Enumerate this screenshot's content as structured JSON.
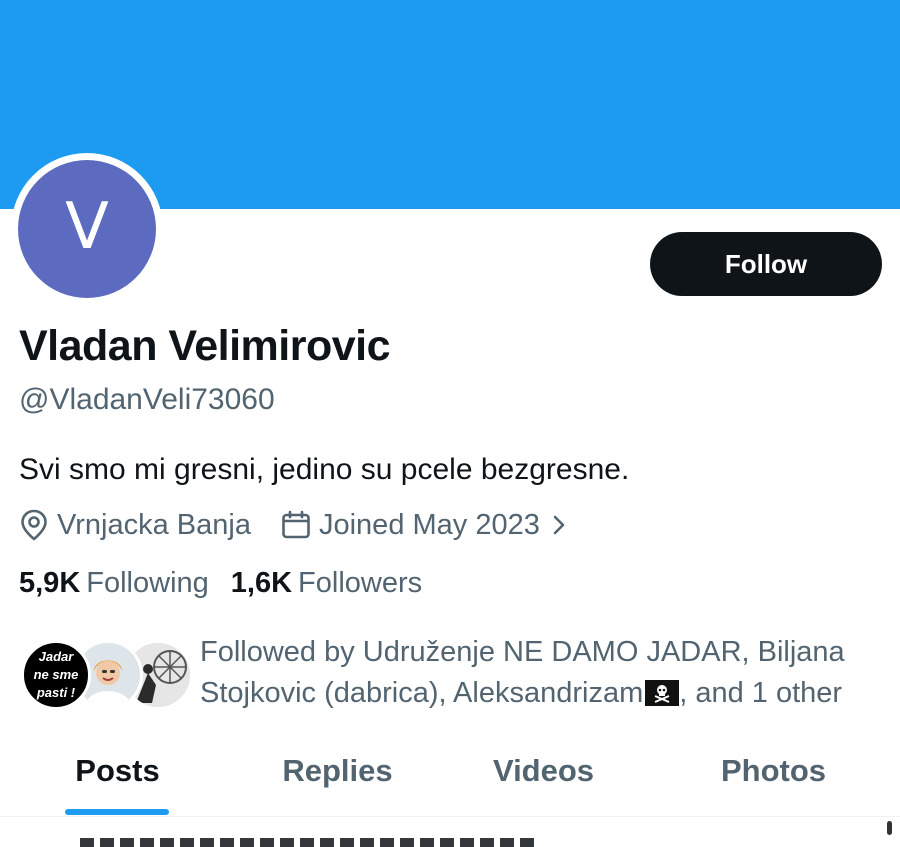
{
  "profile": {
    "avatar_letter": "V",
    "display_name": "Vladan Velimirovic",
    "handle": "@VladanVeli73060",
    "bio": "Svi smo mi gresni, jedino su pcele bezgresne.",
    "location": "Vrnjacka Banja",
    "joined": "Joined May 2023"
  },
  "actions": {
    "follow_label": "Follow"
  },
  "stats": {
    "following_count": "5,9K",
    "following_label": "Following",
    "followers_count": "1,6K",
    "followers_label": "Followers"
  },
  "followed_by": {
    "prefix": "Followed by Udruženje NE DAMO JADAR, Biljana Stojkovic (dabrica), Aleksandrizam",
    "suffix": ", and 1 other",
    "avatar_1_text": [
      "Jadar",
      "ne sme",
      "pasti !"
    ]
  },
  "tabs": [
    {
      "label": "Posts",
      "active": true
    },
    {
      "label": "Replies",
      "active": false
    },
    {
      "label": "Videos",
      "active": false
    },
    {
      "label": "Photos",
      "active": false
    }
  ],
  "colors": {
    "banner": "#1d9bf0",
    "avatar": "#5c6bc0",
    "accent": "#1d9bf0",
    "text_primary": "#0f1419",
    "text_secondary": "#536471"
  },
  "icons": {
    "location": "location-pin-icon",
    "joined": "calendar-icon",
    "expand": "chevron-right-icon",
    "flag": "pirate-flag-icon"
  }
}
